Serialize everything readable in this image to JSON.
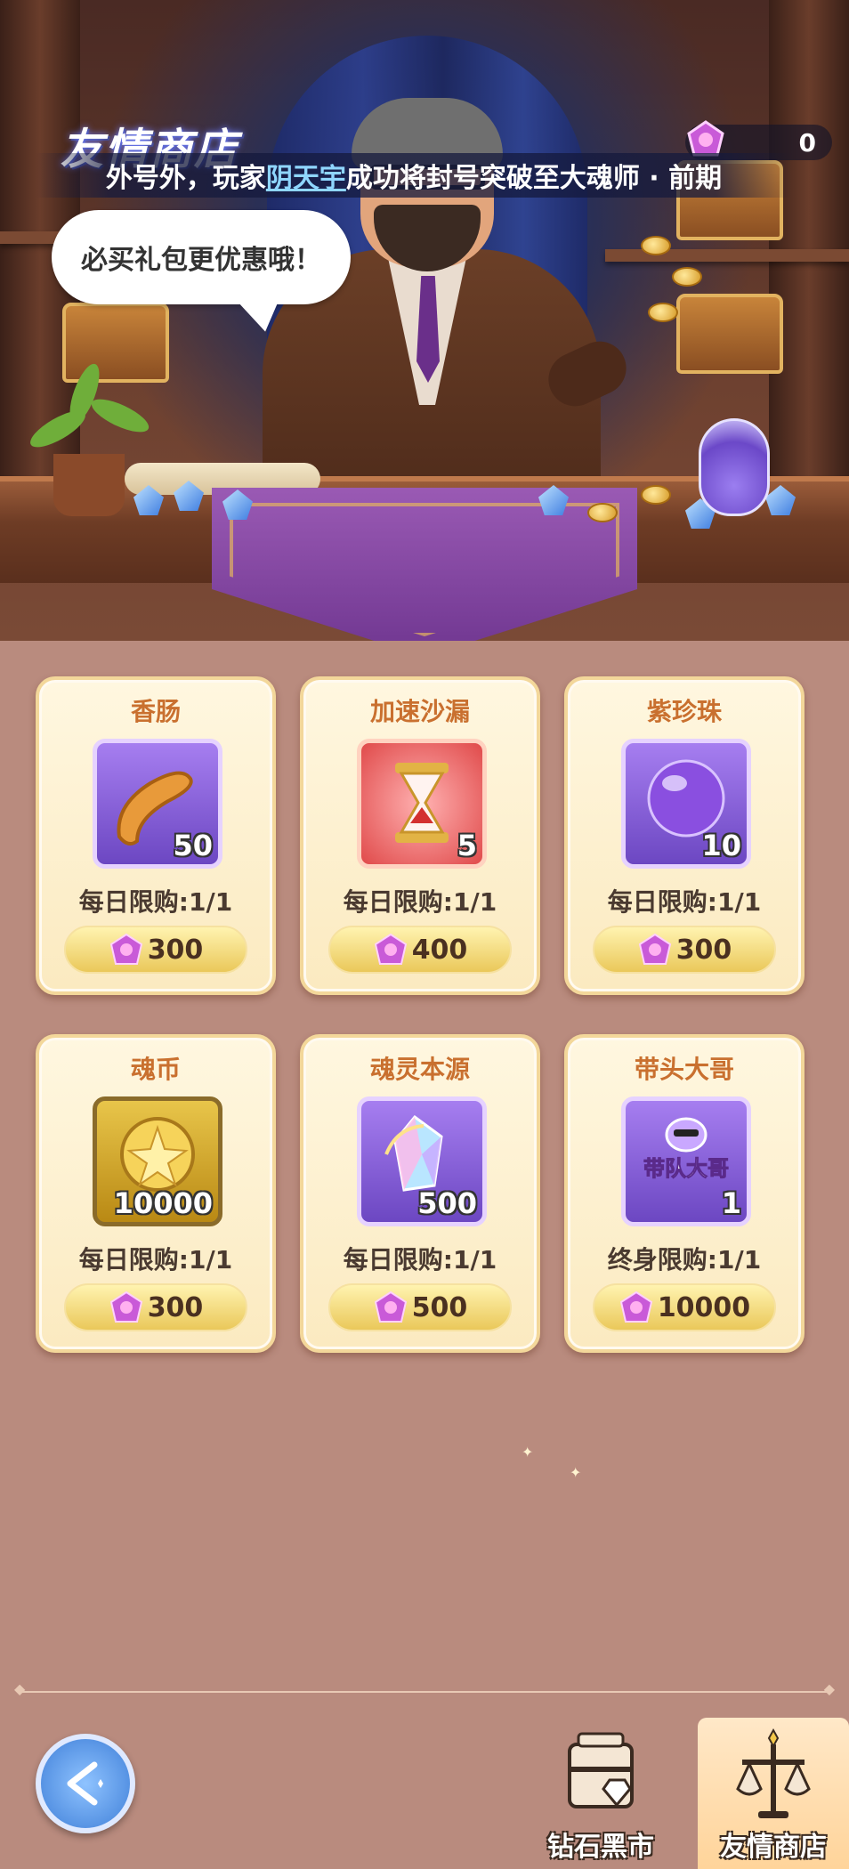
{
  "header": {
    "title": "友情商店",
    "notice_prefix": "外号外，玩家",
    "notice_player": "阴天宇",
    "notice_suffix": "成功将封号突破至大魂师 · 前期",
    "currency_value": "0"
  },
  "speech_bubble": "必买礼包更优惠哦！",
  "items": [
    {
      "name": "香肠",
      "qty": "50",
      "limit": "每日限购:1/1",
      "price": "300",
      "icon": "sausage-icon"
    },
    {
      "name": "加速沙漏",
      "qty": "5",
      "limit": "每日限购:1/1",
      "price": "400",
      "icon": "hourglass-icon"
    },
    {
      "name": "紫珍珠",
      "qty": "10",
      "limit": "每日限购:1/1",
      "price": "300",
      "icon": "purple-pearl-icon"
    },
    {
      "name": "魂币",
      "qty": "10000",
      "limit": "每日限购:1/1",
      "price": "300",
      "icon": "soul-coin-icon"
    },
    {
      "name": "魂灵本源",
      "qty": "500",
      "limit": "每日限购:1/1",
      "price": "500",
      "icon": "soul-crystal-icon"
    },
    {
      "name": "带头大哥",
      "qty": "1",
      "limit": "终身限购:1/1",
      "price": "10000",
      "icon": "boss-badge-icon",
      "badge_text": "带队大哥"
    }
  ],
  "nav": {
    "diamond_market": "钻石黑市",
    "friendship_shop": "友情商店"
  },
  "colors": {
    "background": "#b98b7e",
    "card_title": "#c9702f",
    "price_button": "#eac85a",
    "accent_purple": "#8a55c8"
  }
}
